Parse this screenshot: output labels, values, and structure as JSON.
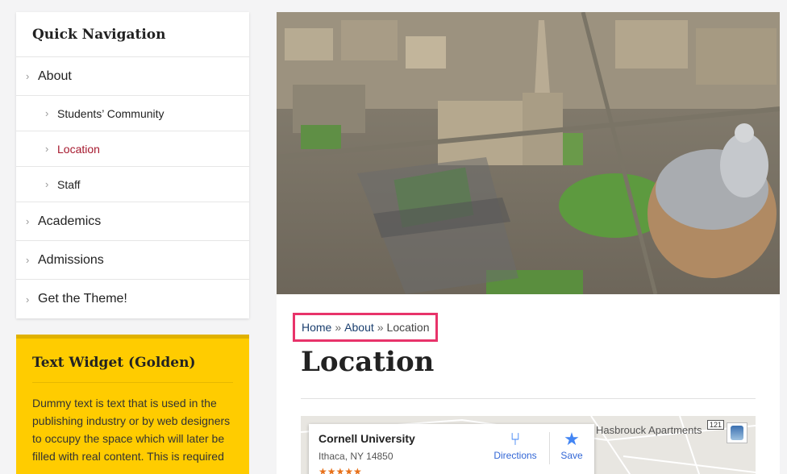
{
  "sidebar": {
    "nav_title": "Quick Navigation",
    "items": [
      {
        "label": "About",
        "level": 1
      },
      {
        "label": "Students’ Community",
        "level": 2
      },
      {
        "label": "Location",
        "level": 2,
        "active": true
      },
      {
        "label": "Staff",
        "level": 2
      },
      {
        "label": "Academics",
        "level": 1
      },
      {
        "label": "Admissions",
        "level": 1
      },
      {
        "label": "Get the Theme!",
        "level": 1
      }
    ],
    "widget": {
      "title": "Text Widget (Golden)",
      "text": "Dummy text is text that is used in the publishing industry or by web designers to occupy the space which will later be filled with real content. This is required"
    }
  },
  "breadcrumb": {
    "home": "Home",
    "sep1": "»",
    "about": "About",
    "sep2": "»",
    "current": "Location"
  },
  "page": {
    "title": "Location"
  },
  "map": {
    "place_name": "Cornell University",
    "address": "Ithaca, NY 14850",
    "directions_label": "Directions",
    "save_label": "Save",
    "nearby_label": "Hasbrouck Apartments",
    "road_number": "121"
  },
  "colors": {
    "accent": "#a6192e",
    "widget_bg": "#ffcc00",
    "highlight": "#e8336a",
    "link": "#1a3e6e"
  }
}
